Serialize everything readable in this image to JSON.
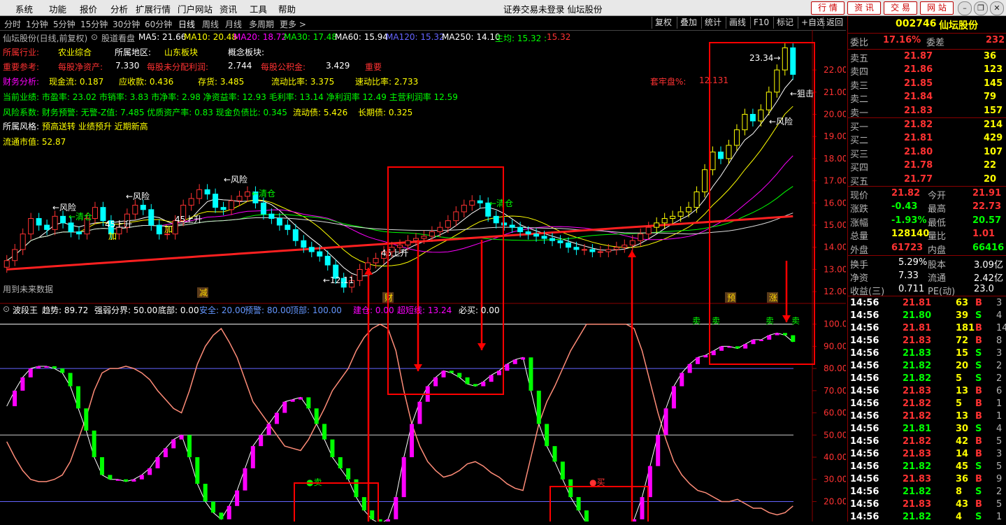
{
  "menu": [
    "系统",
    "功能",
    "报价",
    "分析",
    "扩展行情",
    "门户网站",
    "资讯",
    "工具",
    "帮助"
  ],
  "window_title": "证券交易未登录  仙坛股份",
  "top_buttons": [
    "行 情",
    "资 讯",
    "交 易",
    "网 站"
  ],
  "period_tabs": [
    "分时",
    "1分钟",
    "5分钟",
    "15分钟",
    "30分钟",
    "60分钟",
    "日线",
    "周线",
    "月线",
    "多周期",
    "更多 >"
  ],
  "period_active": "日线",
  "right_tools": [
    "复权",
    "叠加",
    "统计",
    "画线",
    "F10",
    "标记",
    "+自选",
    "返回"
  ],
  "chart_header": {
    "stock": "仙坛股份(日线,前复权)",
    "indicator": "股道看盘",
    "ma5": "MA5: 21.66",
    "ma10": "MA10: 20.48",
    "ma20": "MA20: 18.72",
    "ma30": "MA30: 17.48",
    "ma60": "MA60: 15.94",
    "ma120": "MA120: 15.32",
    "ma250": "MA250: 14.10",
    "zhujun": "主均: 15.32 :",
    "zhujun2": "15.32"
  },
  "fundamentals": {
    "industry_label": "所属行业:",
    "industry": "农业综合",
    "region_label": "所属地区:",
    "region": "山东板块",
    "concept_label": "概念板块:",
    "important_label": "重要参考:",
    "nav_label": "每股净资产:",
    "nav": "7.330",
    "undist_label": "每股未分配利润:",
    "undist": "2.744",
    "reserve_label": "每股公积金:",
    "reserve": "3.429",
    "important2": "重要",
    "fin_label": "财务分析:",
    "cashflow": "现金流:  0.187",
    "receivable": "应收款:  0.436",
    "inventory": "存货:  3.485",
    "current_ratio": "流动比率:  3.375",
    "quick_ratio": "速动比率:  2.733",
    "trap_label": "套牢盘%:",
    "trap": "12.131",
    "perf_line": "当前业绩: 市盈率: 23.02 市销率: 3.83 市净率: 2.98 净资益率: 12.93 毛利率: 13.14 净利润率 12.49 主营利润率 12.59",
    "risk_line": "风险系数: 财务预警: 无警-Z值: 7.485 优质资产率: 0.83 现金负债比: 0.345",
    "current_debt": "流动债:  5.426",
    "long_debt": "长期债:  0.325",
    "style_label": "所属风格:",
    "style": "预高送转 业绩预升 近期新高",
    "float_cap": "流通市值:  52.87"
  },
  "chart_data": [
    {
      "type": "candlestick",
      "y_ticks": [
        12.0,
        13.0,
        14.0,
        15.0,
        16.0,
        17.0,
        18.0,
        19.0,
        20.0,
        21.0,
        22.0
      ],
      "ylim": [
        11.5,
        23.8
      ],
      "closes": [
        13.4,
        13.9,
        14.6,
        15.3,
        15.0,
        14.8,
        15.4,
        15.1,
        14.7,
        14.6,
        15.3,
        15.8,
        15.2,
        14.6,
        14.9,
        15.5,
        15.9,
        15.7,
        15.0,
        14.6,
        14.6,
        15.2,
        15.9,
        16.2,
        16.6,
        16.4,
        15.8,
        15.7,
        16.1,
        16.3,
        16.5,
        16.0,
        15.5,
        15.3,
        15.0,
        14.8,
        14.3,
        14.0,
        13.8,
        13.6,
        13.2,
        12.6,
        12.2,
        12.5,
        13.0,
        13.3,
        13.5,
        13.8,
        14.0,
        14.1,
        14.3,
        14.4,
        14.5,
        14.7,
        14.9,
        15.2,
        15.6,
        15.9,
        16.1,
        16.0,
        15.4,
        15.1,
        15.0,
        14.9,
        14.7,
        14.6,
        14.5,
        14.4,
        14.3,
        14.2,
        14.0,
        13.9,
        13.9,
        13.8,
        13.8,
        13.9,
        14.0,
        14.1,
        14.3,
        14.6,
        14.9,
        15.1,
        15.3,
        15.4,
        15.6,
        15.8,
        16.5,
        17.5,
        18.3,
        18.0,
        18.6,
        19.3,
        20.0,
        19.7,
        20.2,
        21.0,
        22.0,
        23.0,
        21.8
      ],
      "price_labels": [
        "12.11",
        "23.34"
      ],
      "signal_labels": [
        "←风险",
        "←清仓",
        "加",
        "45上升",
        "←风险",
        "45上升",
        "←风险",
        "←清仓",
        "45上升",
        "←狙击",
        "←风险",
        "←清仓",
        "加",
        "减",
        "财",
        "预",
        "涨"
      ],
      "note": "用到未来数据"
    },
    {
      "type": "line",
      "title": "波段王",
      "trend": "趋势: 89.72",
      "strong_weak": "强弱分界: 50.00",
      "bottom": "底部: 0.00",
      "safe": "安全: 20.00",
      "warn": "预警: 80.00",
      "top": "顶部: 100.00",
      "jiancang": "建仓: 0.00",
      "chaoduan": "超短线: 13.24",
      "bimai": "必买: 0.00",
      "y_ticks": [
        20,
        30,
        40,
        50,
        60,
        70,
        80,
        90,
        100
      ],
      "ylim": [
        11,
        104
      ],
      "trend_values": [
        63,
        70,
        76,
        80,
        81,
        81,
        80,
        78,
        72,
        62,
        52,
        40,
        32,
        30,
        30,
        29,
        30,
        32,
        35,
        40,
        44,
        48,
        50,
        40,
        28,
        20,
        15,
        12,
        18,
        25,
        35,
        45,
        50,
        55,
        60,
        65,
        66,
        67,
        62,
        55,
        48,
        40,
        35,
        30,
        22,
        16,
        12,
        10,
        12,
        22,
        40,
        55,
        65,
        72,
        76,
        79,
        78,
        76,
        73,
        72,
        74,
        77,
        79,
        82,
        84,
        85,
        70,
        55,
        45,
        38,
        30,
        22,
        16,
        10,
        8,
        6,
        5,
        6,
        7,
        12,
        22,
        36,
        50,
        62,
        72,
        78,
        82,
        85,
        86,
        88,
        90,
        90,
        89,
        91,
        93,
        93,
        95,
        96,
        95,
        92
      ],
      "zone_labels": [
        "卖",
        "卖",
        "卖",
        "卖",
        "●卖",
        "●买"
      ]
    }
  ],
  "quote": {
    "code": "002746",
    "name": "仙坛股份",
    "weibi_label": "委比",
    "weibi": "17.16%",
    "weicha_label": "委差",
    "weicha": "232",
    "sells": [
      {
        "label": "卖五",
        "price": "21.87",
        "vol": "36"
      },
      {
        "label": "卖四",
        "price": "21.86",
        "vol": "123"
      },
      {
        "label": "卖三",
        "price": "21.85",
        "vol": "145"
      },
      {
        "label": "卖二",
        "price": "21.84",
        "vol": "79"
      },
      {
        "label": "卖一",
        "price": "21.83",
        "vol": "157"
      }
    ],
    "buys": [
      {
        "label": "买一",
        "price": "21.82",
        "vol": "214"
      },
      {
        "label": "买二",
        "price": "21.81",
        "vol": "429"
      },
      {
        "label": "买三",
        "price": "21.80",
        "vol": "107"
      },
      {
        "label": "买四",
        "price": "21.78",
        "vol": "22"
      },
      {
        "label": "买五",
        "price": "21.77",
        "vol": "20"
      }
    ],
    "stats": [
      {
        "l1": "现价",
        "v1": "21.82",
        "c1": "#ff3232",
        "l2": "今开",
        "v2": "21.91",
        "c2": "#ff3232"
      },
      {
        "l1": "涨跌",
        "v1": "-0.43",
        "c1": "#00ff00",
        "l2": "最高",
        "v2": "22.73",
        "c2": "#ff3232"
      },
      {
        "l1": "涨幅",
        "v1": "-1.93%",
        "c1": "#00ff00",
        "l2": "最低",
        "v2": "20.57",
        "c2": "#00ff00"
      },
      {
        "l1": "总量",
        "v1": "128140",
        "c1": "#ffff00",
        "l2": "量比",
        "v2": "1.01",
        "c2": "#ff3232"
      },
      {
        "l1": "外盘",
        "v1": "61723",
        "c1": "#ff3232",
        "l2": "内盘",
        "v2": "66416",
        "c2": "#00ff00"
      }
    ],
    "stats2": [
      {
        "l1": "换手",
        "v1": "5.29%",
        "l2": "股本",
        "v2": "3.09亿"
      },
      {
        "l1": "净资",
        "v1": "7.33",
        "l2": "流通",
        "v2": "2.42亿"
      },
      {
        "l1": "收益(三)",
        "v1": "0.711",
        "l2": "PE(动)",
        "v2": "23.0"
      }
    ],
    "ticks": [
      {
        "t": "14:56",
        "p": "21.81",
        "v": "63",
        "bs": "B",
        "n": "3"
      },
      {
        "t": "14:56",
        "p": "21.80",
        "v": "39",
        "bs": "S",
        "n": "4"
      },
      {
        "t": "14:56",
        "p": "21.81",
        "v": "181",
        "bs": "B",
        "n": "14"
      },
      {
        "t": "14:56",
        "p": "21.83",
        "v": "72",
        "bs": "B",
        "n": "8"
      },
      {
        "t": "14:56",
        "p": "21.83",
        "v": "15",
        "bs": "S",
        "n": "3"
      },
      {
        "t": "14:56",
        "p": "21.82",
        "v": "20",
        "bs": "S",
        "n": "2"
      },
      {
        "t": "14:56",
        "p": "21.82",
        "v": "5",
        "bs": "S",
        "n": "2"
      },
      {
        "t": "14:56",
        "p": "21.83",
        "v": "13",
        "bs": "B",
        "n": "6"
      },
      {
        "t": "14:56",
        "p": "21.82",
        "v": "5",
        "bs": "B",
        "n": "1"
      },
      {
        "t": "14:56",
        "p": "21.82",
        "v": "13",
        "bs": "B",
        "n": "1"
      },
      {
        "t": "14:56",
        "p": "21.81",
        "v": "30",
        "bs": "S",
        "n": "4"
      },
      {
        "t": "14:56",
        "p": "21.82",
        "v": "42",
        "bs": "B",
        "n": "5"
      },
      {
        "t": "14:56",
        "p": "21.83",
        "v": "14",
        "bs": "B",
        "n": "3"
      },
      {
        "t": "14:56",
        "p": "21.82",
        "v": "45",
        "bs": "S",
        "n": "5"
      },
      {
        "t": "14:56",
        "p": "21.83",
        "v": "36",
        "bs": "B",
        "n": "9"
      },
      {
        "t": "14:56",
        "p": "21.82",
        "v": "8",
        "bs": "S",
        "n": "2"
      },
      {
        "t": "14:56",
        "p": "21.83",
        "v": "43",
        "bs": "B",
        "n": "5"
      },
      {
        "t": "14:56",
        "p": "21.82",
        "v": "4",
        "bs": "S",
        "n": "1"
      }
    ]
  },
  "colors": {
    "up": "#ff3232",
    "down": "#00ff00",
    "accent": "#ffff00",
    "frame": "#8b0000"
  }
}
